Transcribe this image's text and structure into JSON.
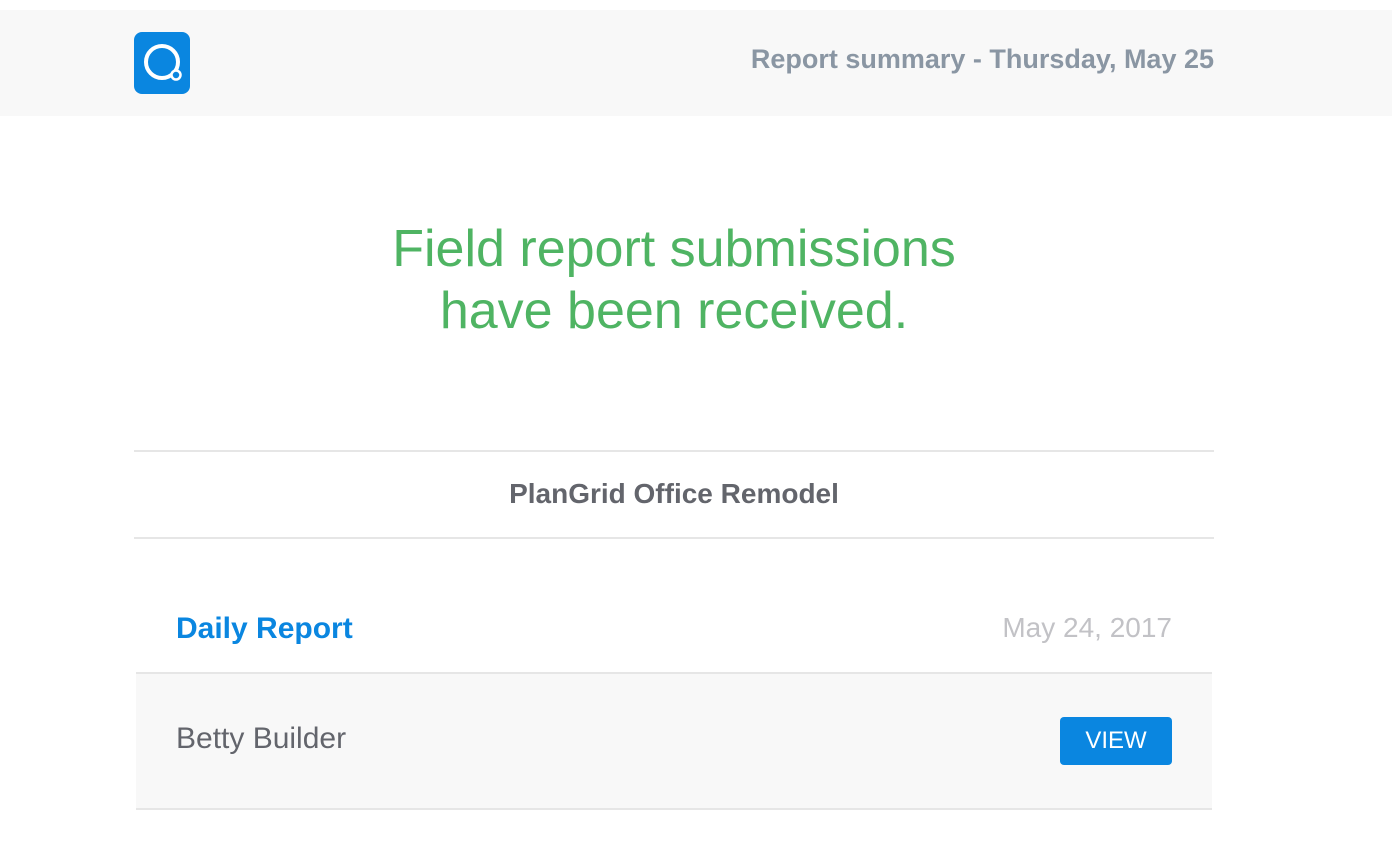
{
  "header": {
    "logo_icon": "plangrid-logo-icon",
    "summary": "Report summary - Thursday, May 25"
  },
  "headline": {
    "line1": "Field report submissions",
    "line2": "have been received."
  },
  "project": {
    "name": "PlanGrid Office Remodel"
  },
  "report": {
    "title": "Daily Report",
    "date": "May 24, 2017",
    "submitter": "Betty Builder",
    "view_label": "VIEW"
  },
  "colors": {
    "brand_blue": "#0a86e0",
    "headline_green": "#4fb463",
    "muted_gray": "#8a96a3"
  }
}
